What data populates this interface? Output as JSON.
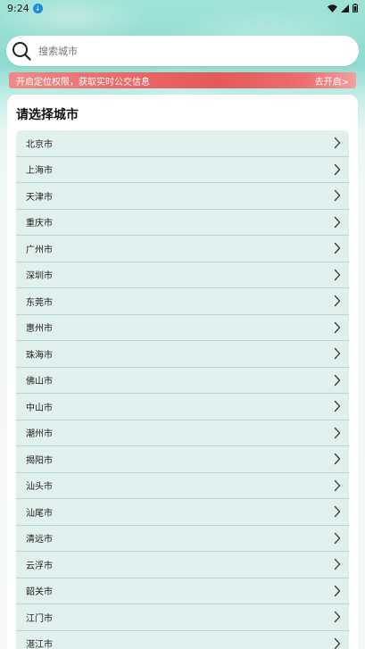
{
  "status_bar": {
    "time": "9:24",
    "download_badge": "↓",
    "icons": [
      "wifi-icon",
      "signal-icon",
      "battery-icon"
    ]
  },
  "search": {
    "placeholder": "搜索城市",
    "value": ""
  },
  "banner": {
    "text": "开启定位权限，获取实时公交信息",
    "action": "去开启>"
  },
  "card": {
    "title": "请选择城市"
  },
  "cities": [
    "北京市",
    "上海市",
    "天津市",
    "重庆市",
    "广州市",
    "深圳市",
    "东莞市",
    "惠州市",
    "珠海市",
    "佛山市",
    "中山市",
    "潮州市",
    "揭阳市",
    "汕头市",
    "汕尾市",
    "清远市",
    "云浮市",
    "韶关市",
    "江门市",
    "湛江市"
  ],
  "colors": {
    "banner": "#e45858",
    "list_item_bg": "#e1efed",
    "list_divider": "#b9d8d3"
  }
}
